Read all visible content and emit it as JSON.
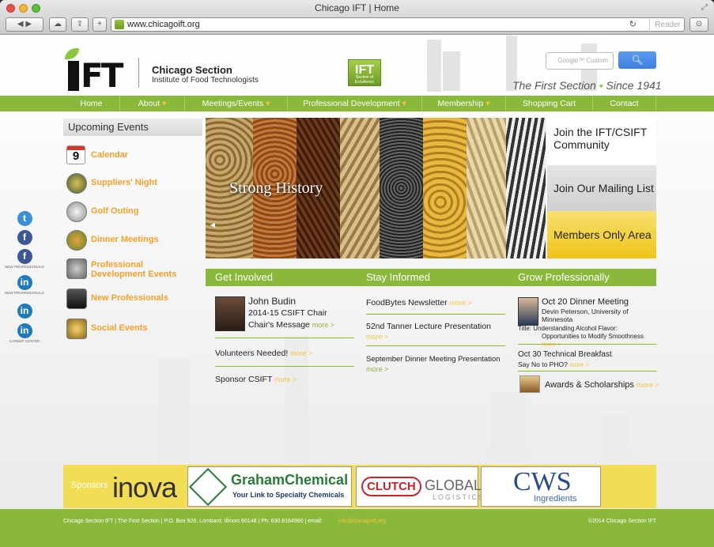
{
  "browser": {
    "window_title": "Chicago IFT | Home",
    "url": "www.chicagoift.org",
    "reader_label": "Reader",
    "reload_icon": "reload-icon"
  },
  "header": {
    "logo_text": "IFT",
    "org_name": "Chicago Section",
    "org_subtitle": "Institute of Food Technologists",
    "badge_text": "IFT",
    "badge_sub": "Section of Excellence",
    "search_placeholder": "Google™ Custom",
    "tagline_a": "The First Section",
    "tagline_dot": "•",
    "tagline_b": "Since 1941"
  },
  "nav": [
    {
      "label": "Home",
      "caret": ""
    },
    {
      "label": "About",
      "caret": " ▾"
    },
    {
      "label": "Meetings/Events",
      "caret": " ▾"
    },
    {
      "label": "Professional Development",
      "caret": " ▾"
    },
    {
      "label": "Membership",
      "caret": " ▾"
    },
    {
      "label": "Shopping Cart",
      "caret": ""
    },
    {
      "label": "Contact",
      "caret": ""
    }
  ],
  "events": {
    "heading": "Upcoming Events",
    "calendar_day": "9",
    "items": [
      {
        "label": "Calendar",
        "icon": "calendar-icon"
      },
      {
        "label": "Suppliers' Night",
        "icon": "suppliers-icon"
      },
      {
        "label": "Golf Outing",
        "icon": "golf-ball-icon"
      },
      {
        "label": "Dinner Meetings",
        "icon": "dinner-plate-icon"
      },
      {
        "label": "Professional Development Events",
        "icon": "gear-icon"
      },
      {
        "label": "New Professionals",
        "icon": "briefcase-icon"
      },
      {
        "label": "Social Events",
        "icon": "drink-icon"
      }
    ]
  },
  "social": [
    {
      "icon": "twitter-icon",
      "glyph": "t",
      "color": "#3b8fd6",
      "caption": ""
    },
    {
      "icon": "facebook-icon",
      "glyph": "f",
      "color": "#3b5998",
      "caption": ""
    },
    {
      "icon": "facebook-icon",
      "glyph": "f",
      "color": "#3b5998",
      "caption": "NEW PROFESSIONALS"
    },
    {
      "icon": "linkedin-icon",
      "glyph": "in",
      "color": "#1e7ab8",
      "caption": "NEW PROFESSIONALS"
    },
    {
      "icon": "linkedin-icon",
      "glyph": "in",
      "color": "#1e7ab8",
      "caption": ""
    },
    {
      "icon": "linkedin-icon",
      "glyph": "in",
      "color": "#1e7ab8",
      "caption": "CAREER CENTER"
    }
  ],
  "hero": {
    "caption": "Strong History",
    "arrow": "◂"
  },
  "side_buttons": {
    "join": "Join the IFT/CSIFT Community",
    "mailing": "Join Our Mailing List",
    "members": "Members Only Area"
  },
  "sections": {
    "involved": "Get Involved",
    "informed": "Stay Informed",
    "grow": "Grow Professionally"
  },
  "involved": {
    "name": "John Budin",
    "role": "2014-15 CSIFT Chair",
    "chairs_message": "Chair's Message",
    "volunteers": "Volunteers Needed!",
    "sponsor": "Sponsor CSIFT",
    "more": "more >"
  },
  "informed": {
    "item1": "FoodBytes Newsletter",
    "item2": "52nd Tanner Lecture Presentation",
    "item3": "September Dinner Meeting Presentation",
    "more": "more >"
  },
  "grow": {
    "oct20_title": "Oct 20 Dinner Meeting",
    "oct20_speaker": "Devin Peterson, University of Minnesota",
    "oct20_topic": "Title: Understanding Alcohol Flavor: Opportunities to Modify Smoothness",
    "oct30_title": "Oct 30 Technical Breakfast",
    "oct30_sub": "Say No to PHO?",
    "awards": "Awards & Scholarships",
    "more": "more >"
  },
  "sponsors": {
    "label": "Sponsors",
    "inova": "inova",
    "graham_a": "Graham",
    "graham_b": "Chemical",
    "graham_tag": "Your Link to Specialty Chemicals",
    "clutch": "CLUTCH",
    "clutch_global": "GLOBAL",
    "clutch_sub": "LOGISTICS",
    "cws": "CWS",
    "cws_sub": "Ingredients"
  },
  "footer": {
    "address": "Chicago Section IFT | The First Section | P.O. Box 926, Lombard, Illinois 60148 | Ph: 630.8164960 | email:",
    "email": "info@chicagoift.org",
    "copyright": "©2014 Chicago Section IFT"
  },
  "colors": {
    "brand_green": "#8ab83b",
    "accent_orange": "#f2a12b",
    "accent_yellow": "#f5c542"
  }
}
